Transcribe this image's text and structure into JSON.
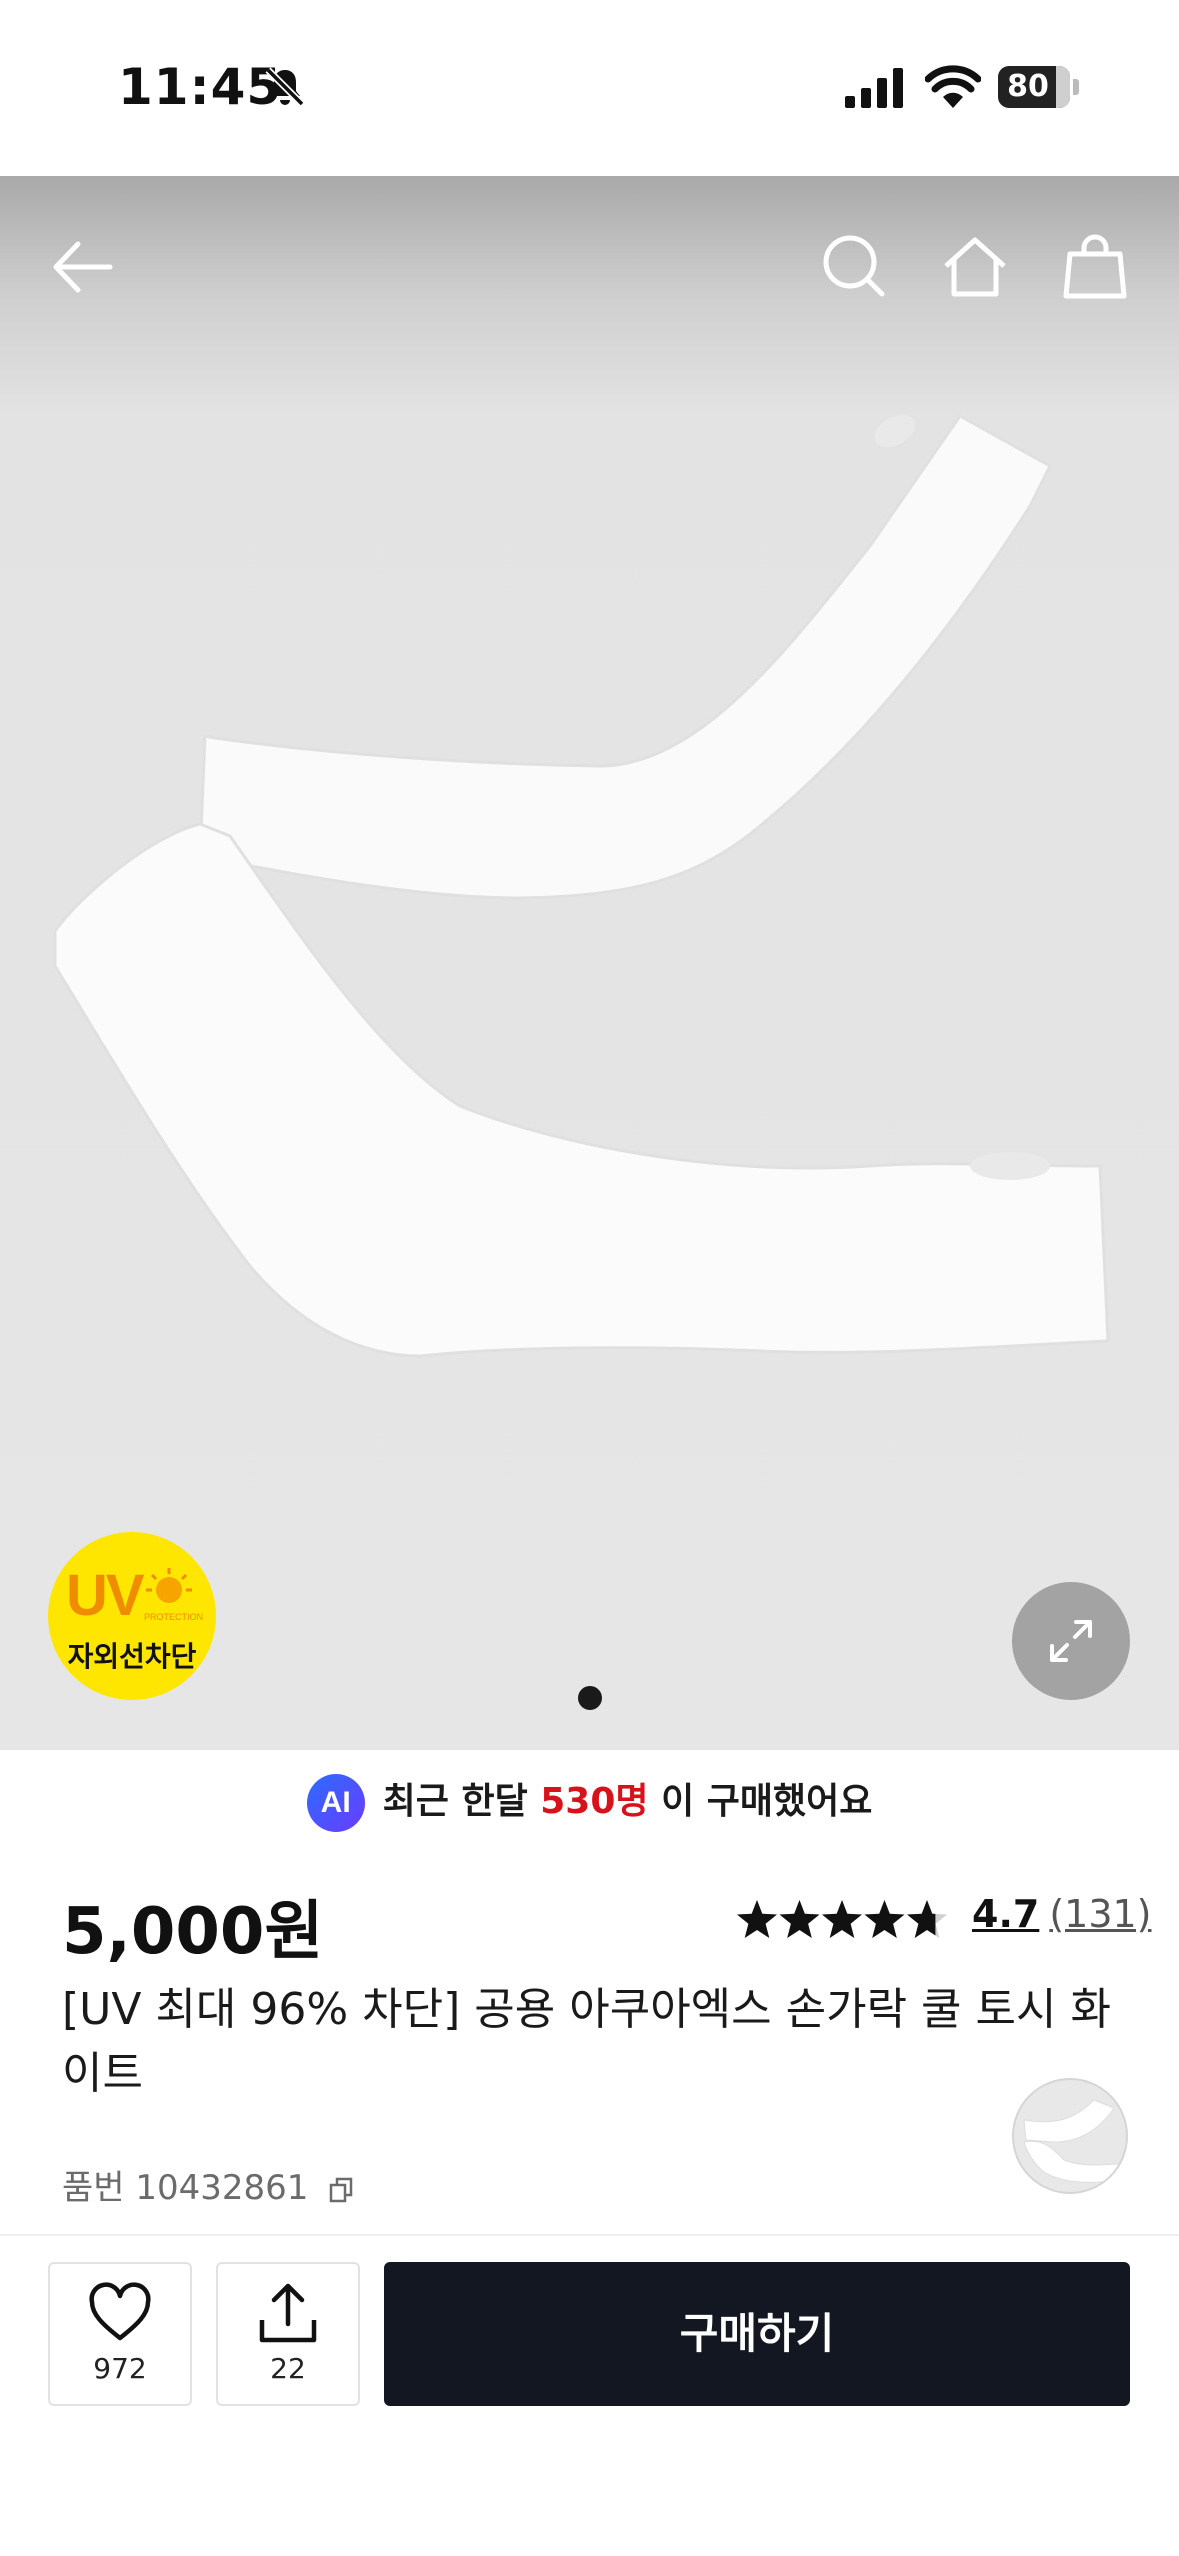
{
  "status_bar": {
    "time": "11:45",
    "battery": "80"
  },
  "nav": {
    "icons": [
      "back-arrow-icon",
      "search-icon",
      "home-icon",
      "shopping-bag-icon"
    ]
  },
  "image": {
    "badge": {
      "main": "UV",
      "small": "PROTECTION",
      "label": "자외선차단"
    },
    "carousel": {
      "current": 1,
      "total": 1
    }
  },
  "ai_banner": {
    "icon": "AI",
    "prefix": "최근 한달",
    "count": "530명",
    "suffix": "이 구매했어요"
  },
  "product": {
    "price": "5,000원",
    "rating": 4.7,
    "rating_text": "4.7",
    "review_count": "(131)",
    "title": "[UV 최대 96% 차단] 공용 아쿠아엑스 손가락 쿨 토시 화이트",
    "sku_label": "품번",
    "sku": "10432861"
  },
  "bottom_bar": {
    "like_count": "972",
    "share_count": "22",
    "buy_label": "구매하기"
  },
  "colors": {
    "accent_red": "#d8121a",
    "buy_button": "#131722",
    "badge_yellow": "#ffe600"
  }
}
